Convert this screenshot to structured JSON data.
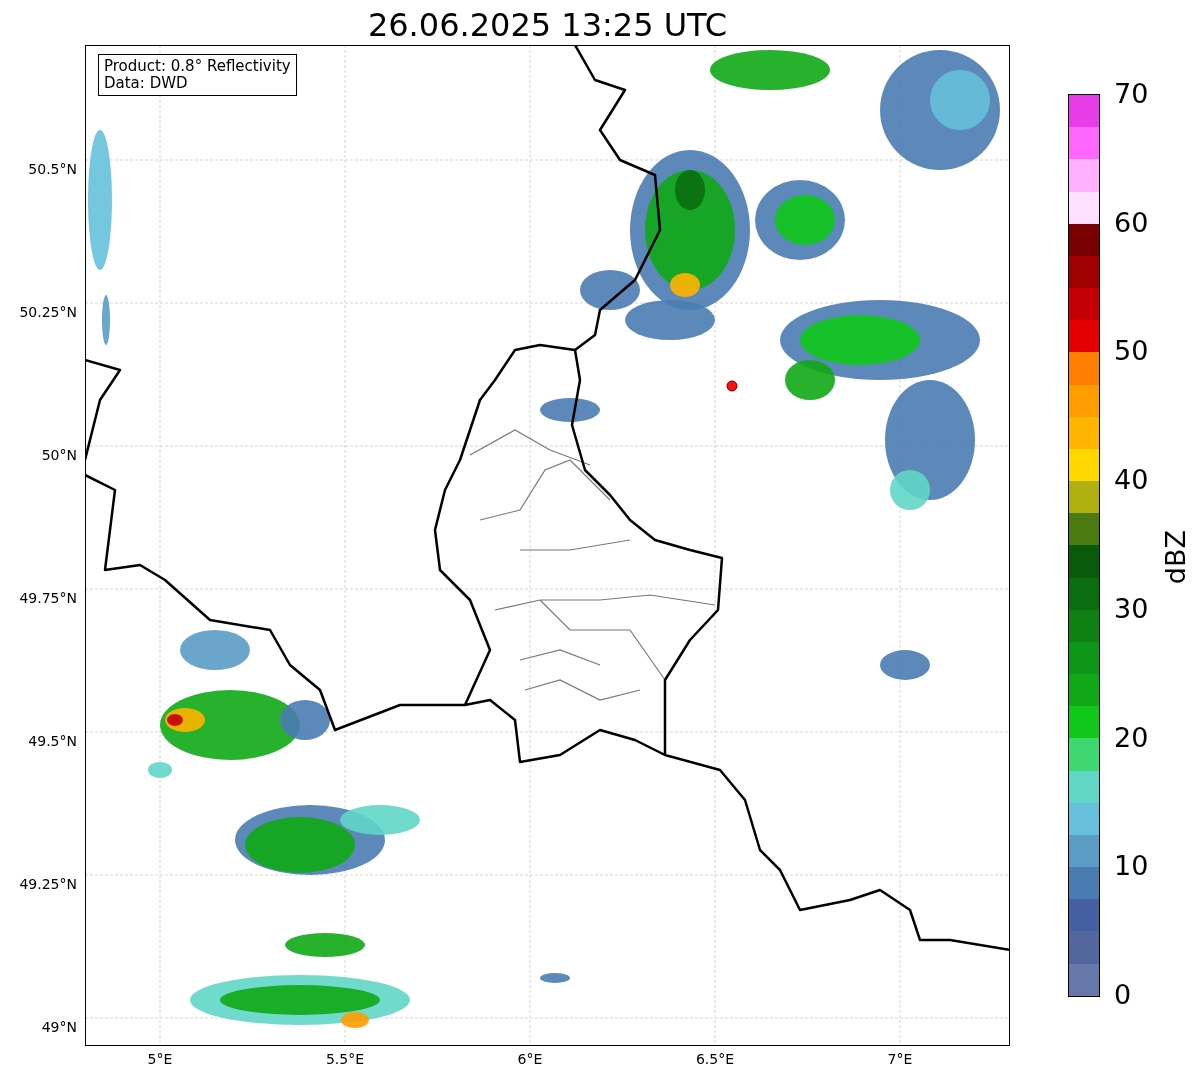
{
  "title": "26.06.2025 13:25 UTC",
  "info_box": {
    "lines": [
      "Product: 0.8° Reflectivity",
      "Data: DWD"
    ]
  },
  "y_ticks": [
    "50.5°N",
    "50.25°N",
    "50°N",
    "49.75°N",
    "49.5°N",
    "49.25°N",
    "49°N"
  ],
  "x_ticks": [
    "5°E",
    "5.5°E",
    "6°E",
    "6.5°E",
    "7°E"
  ],
  "colorbar": {
    "label": "dBZ",
    "ticks": [
      "70",
      "60",
      "50",
      "40",
      "30",
      "20",
      "10",
      "0"
    ],
    "bins": [
      {
        "color": "#e83ce8"
      },
      {
        "color": "#ff66ff"
      },
      {
        "color": "#ffb0ff"
      },
      {
        "color": "#ffe0ff"
      },
      {
        "color": "#780000"
      },
      {
        "color": "#a00000"
      },
      {
        "color": "#c40000"
      },
      {
        "color": "#e40000"
      },
      {
        "color": "#ff8000"
      },
      {
        "color": "#ff9c00"
      },
      {
        "color": "#ffb400"
      },
      {
        "color": "#ffd800"
      },
      {
        "color": "#b0b010"
      },
      {
        "color": "#4a7a10"
      },
      {
        "color": "#0a5a0c"
      },
      {
        "color": "#0a6e10"
      },
      {
        "color": "#0e8014"
      },
      {
        "color": "#0e9618"
      },
      {
        "color": "#10a816"
      },
      {
        "color": "#10c81a"
      },
      {
        "color": "#3ed870"
      },
      {
        "color": "#60d6c6"
      },
      {
        "color": "#66c0dc"
      },
      {
        "color": "#5a9cc6"
      },
      {
        "color": "#4a7cb2"
      },
      {
        "color": "#4460a2"
      },
      {
        "color": "#54669e"
      },
      {
        "color": "#6677aa"
      }
    ]
  }
}
